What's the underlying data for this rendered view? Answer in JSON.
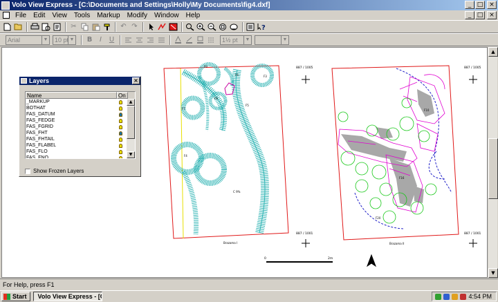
{
  "window": {
    "title": "Volo View Express - [C:\\Documents and Settings\\Holly\\My Documents\\fig4.dxf]",
    "buttons": [
      "_",
      "□",
      "×"
    ]
  },
  "menu": {
    "items": [
      "File",
      "Edit",
      "View",
      "Tools",
      "Markup",
      "Modify",
      "Window",
      "Help"
    ]
  },
  "toolbar1": {
    "icons": [
      "new-icon",
      "open-icon",
      "print-icon",
      "print-preview-icon",
      "preview-icon",
      "cut-icon",
      "copy-icon",
      "paste-icon",
      "format-painter-icon",
      "undo-icon",
      "redo-icon",
      "select-arrow-icon",
      "redline-icon",
      "markup-color-icon",
      "zoom-window-icon",
      "zoom-in-icon",
      "zoom-out-icon",
      "zoom-extents-icon",
      "navigate-icon",
      "properties-icon",
      "help-icon"
    ]
  },
  "toolbar2": {
    "font": "Arial",
    "size": "10 pt",
    "line_width": "1½ pt",
    "style_buttons": [
      "B",
      "I",
      "U"
    ]
  },
  "drawing": {
    "sheet1": {
      "coord_top": "887 / 1005",
      "coord_bottom": "887 / 1001",
      "label": "Brazama I",
      "region_labels": [
        "F9",
        "F3",
        "F7",
        "F6",
        "F8",
        "F4",
        "F5",
        "C 9%"
      ]
    },
    "sheet2": {
      "coord_top": "887 / 1005",
      "coord_bottom": "887 / 1001",
      "label": "Brazama II",
      "region_labels": [
        "F10",
        "F16",
        "F20"
      ]
    },
    "scale": {
      "start": "0",
      "end": "2m"
    },
    "colors": {
      "cyan": "#2FB4B4",
      "red": "#E01818",
      "magenta": "#E000D0",
      "green": "#18C818",
      "blue": "#2020C8",
      "gray": "#A8A8A8"
    }
  },
  "layers_palette": {
    "title": "Layers",
    "columns": [
      "Name",
      "On"
    ],
    "rows": [
      {
        "name": "_MARKUP",
        "on": true,
        "color": "#E8E000"
      },
      {
        "name": "BOTHAT",
        "on": true,
        "color": "#E8E000"
      },
      {
        "name": "FAS_DATUM",
        "on": true,
        "color": "#1870A8"
      },
      {
        "name": "FAS_FEDGE",
        "on": true,
        "color": "#E8E000"
      },
      {
        "name": "FAS_FGRID",
        "on": true,
        "color": "#E8E000"
      },
      {
        "name": "FAS_FHT",
        "on": true,
        "color": "#1870A8"
      },
      {
        "name": "FAS_FHTAIL",
        "on": true,
        "color": "#E8E000"
      },
      {
        "name": "FAS_FLABEL",
        "on": true,
        "color": "#E8E000"
      },
      {
        "name": "FAS_FLO",
        "on": true,
        "color": "#E8E000"
      },
      {
        "name": "FAS_FNO",
        "on": true,
        "color": "#E8E000"
      }
    ],
    "show_frozen_label": "Show Frozen Layers"
  },
  "status": {
    "text": "For Help, press F1"
  },
  "taskbar": {
    "start": "Start",
    "task": "Volo View Express - [C...",
    "clock": "4:54 PM"
  }
}
